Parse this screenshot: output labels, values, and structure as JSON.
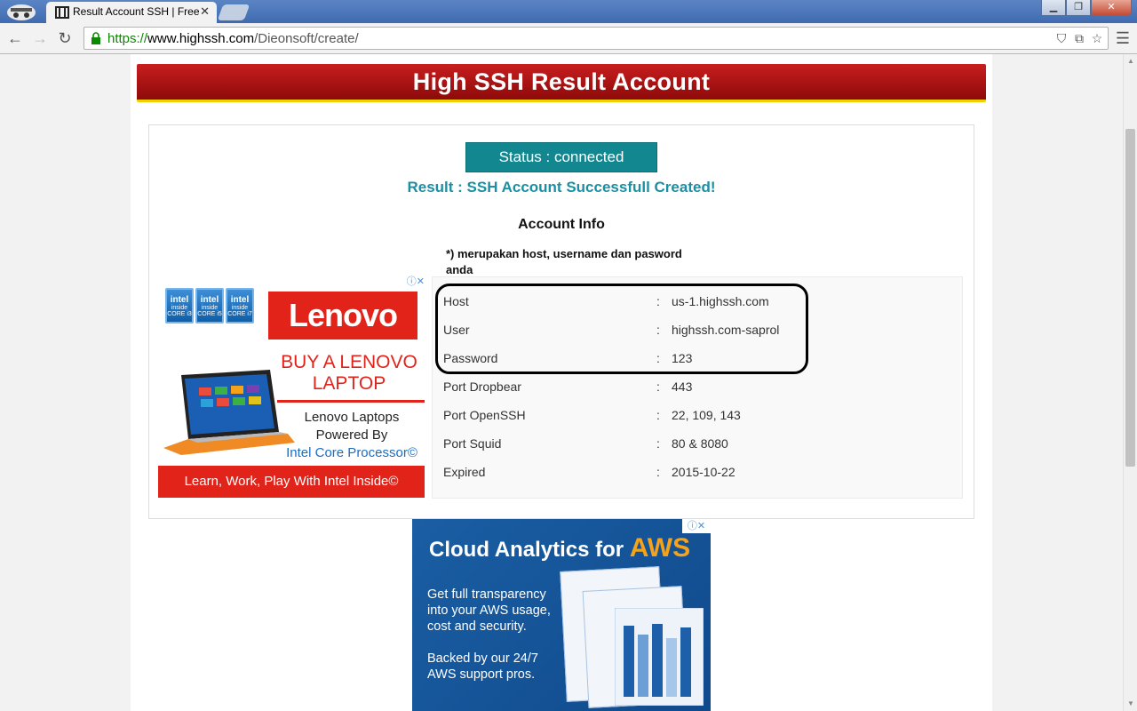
{
  "browser": {
    "tab_title": "Result Account SSH | Free",
    "tab_close": "✕",
    "url_scheme": "https://",
    "url_host": "www.highssh.com",
    "url_path": "/Dieonsoft/create/"
  },
  "page": {
    "banner_title": "High SSH Result Account",
    "status_label": "Status : connected",
    "result_text": "Result : SSH Account Successfull Created!",
    "account_info_title": "Account Info",
    "note": "*) merupakan host, username dan pasword anda",
    "rows": [
      {
        "label": "Host",
        "sep": ":",
        "value": "us-1.highssh.com"
      },
      {
        "label": "User",
        "sep": ":",
        "value": "highssh.com-saprol"
      },
      {
        "label": "Password",
        "sep": ":",
        "value": "123"
      },
      {
        "label": "Port Dropbear",
        "sep": ":",
        "value": "443"
      },
      {
        "label": "Port OpenSSH",
        "sep": ":",
        "value": "22, 109, 143"
      },
      {
        "label": "Port Squid",
        "sep": ":",
        "value": "80 & 8080"
      },
      {
        "label": "Expired",
        "sep": ":",
        "value": "2015-10-22"
      }
    ]
  },
  "ads": {
    "lenovo": {
      "adchoices": "ⓘ✕",
      "chips": [
        {
          "brand": "intel",
          "line1": "inside",
          "model": "CORE i3"
        },
        {
          "brand": "intel",
          "line1": "inside",
          "model": "CORE i5"
        },
        {
          "brand": "intel",
          "line1": "inside",
          "model": "CORE i7"
        }
      ],
      "logo": "Lenovo",
      "headline": "BUY A LENOVO LAPTOP",
      "powered_line1": "Lenovo Laptops",
      "powered_line2": "Powered By",
      "powered_line3": "Intel Core Processor©",
      "bottom_bar": "Learn, Work, Play With Intel Inside©"
    },
    "aws": {
      "adchoices": "ⓘ✕",
      "title_main": "Cloud Analytics for ",
      "title_accent": "AWS",
      "body_line1": "Get full transparency into your AWS usage, cost and security.",
      "body_line2": "Backed by our 24/7 AWS support pros."
    }
  }
}
